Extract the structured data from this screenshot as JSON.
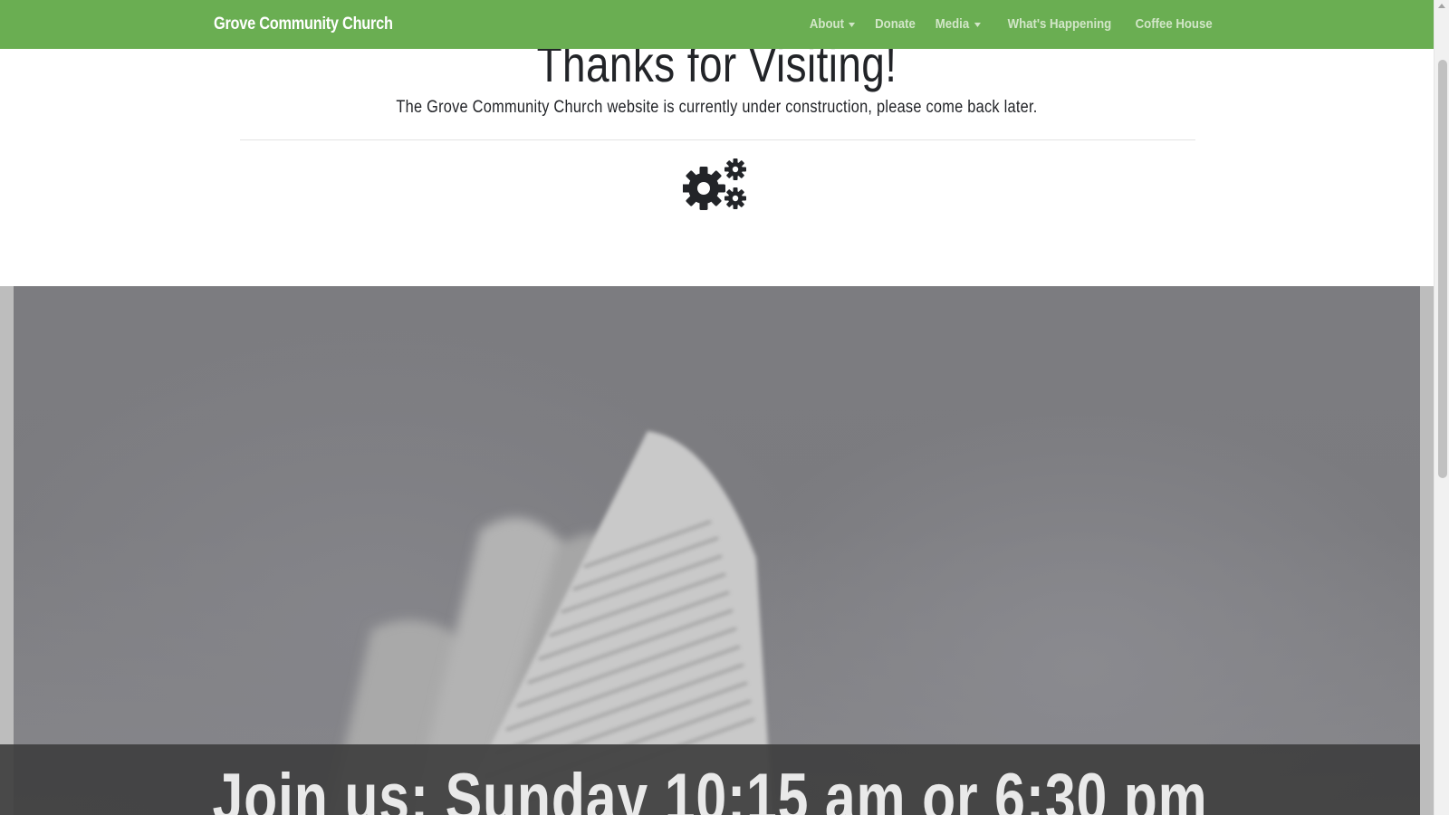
{
  "navbar": {
    "brand": "Grove Community Church",
    "items": [
      {
        "label": "About",
        "dropdown": true
      },
      {
        "label": "Donate",
        "dropdown": false
      },
      {
        "label": "Media",
        "dropdown": true
      },
      {
        "label": "What's Happening",
        "dropdown": false
      },
      {
        "label": "Coffee House",
        "dropdown": false
      }
    ]
  },
  "main": {
    "title": "Thanks for Visiting!",
    "subtitle": "The Grove Community Church website is currently under construction, please come back later.",
    "icon": "gears-icon"
  },
  "hero": {
    "banner_text": "Join us: Sunday 10:15 am or 6:30 pm"
  },
  "colors": {
    "navbar_bg": "#6aae52",
    "text_dark": "#222428",
    "banner_bg": "#404040"
  }
}
